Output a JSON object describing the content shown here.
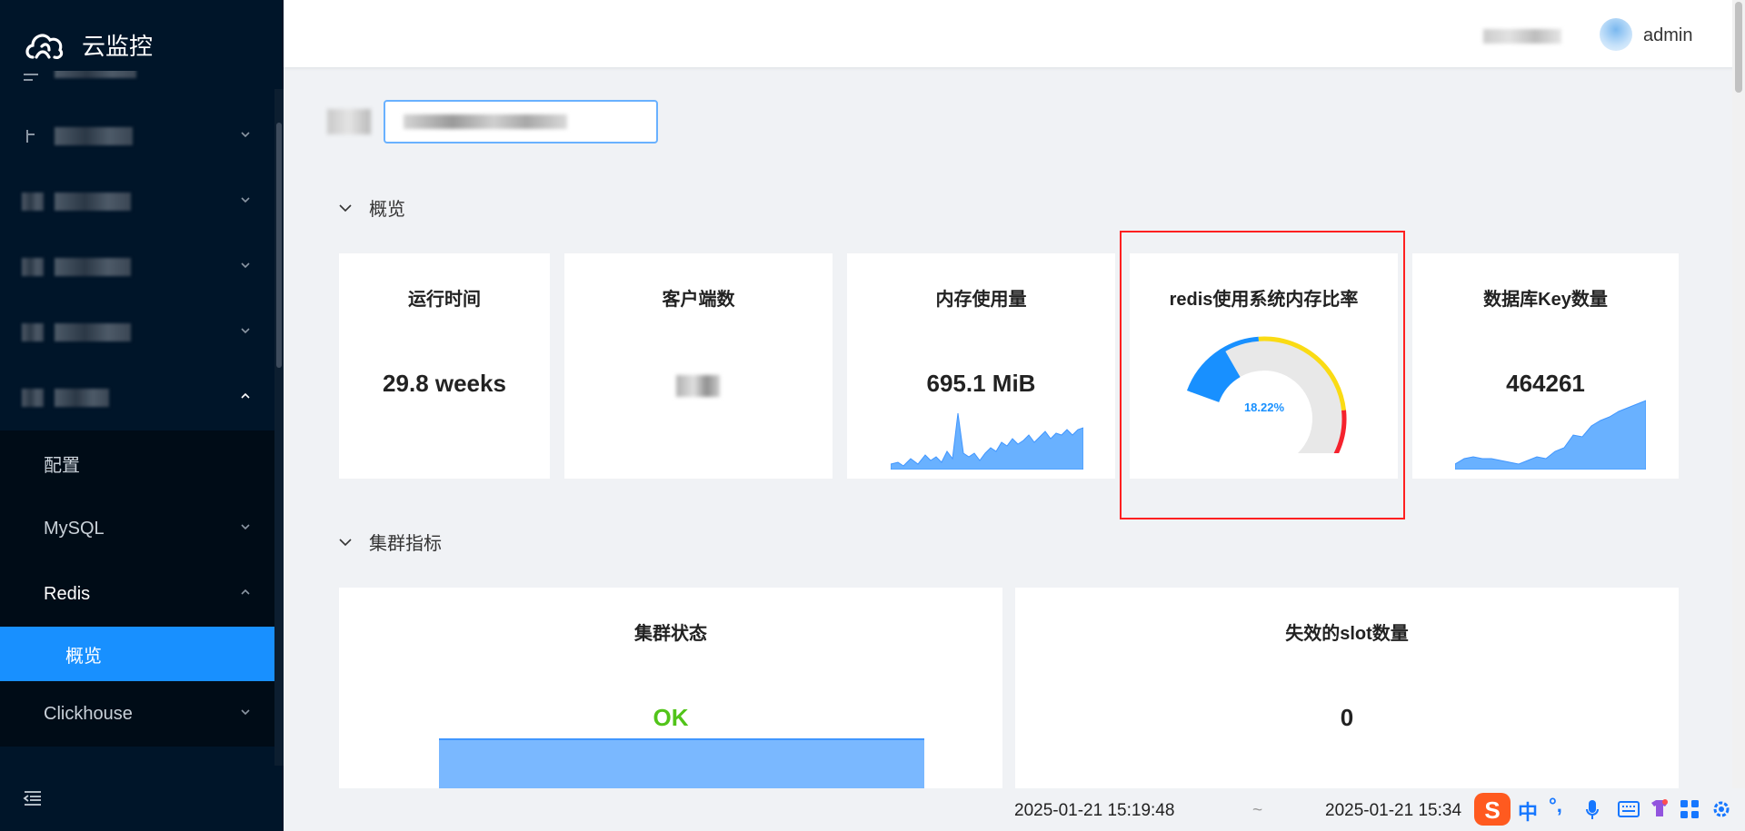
{
  "app": {
    "title": "云监控",
    "user": "admin"
  },
  "sidebar": {
    "submenu_items": [
      {
        "label": "配置"
      },
      {
        "label": "MySQL"
      },
      {
        "label": "Redis"
      },
      {
        "label": "概览"
      },
      {
        "label": "Clickhouse"
      }
    ]
  },
  "sections": {
    "overview": "概览",
    "cluster": "集群指标"
  },
  "overview_cards": {
    "uptime": {
      "title": "运行时间",
      "value": "29.8 weeks"
    },
    "clients": {
      "title": "客户端数"
    },
    "memory": {
      "title": "内存使用量",
      "value": "695.1 MiB"
    },
    "mem_ratio": {
      "title": "redis使用系统内存比率",
      "value": "18.22%",
      "fraction": 0.1822
    },
    "keys": {
      "title": "数据库Key数量",
      "value": "464261"
    }
  },
  "cluster_cards": {
    "state": {
      "title": "集群状态",
      "value": "OK"
    },
    "failed_slots": {
      "title": "失效的slot数量",
      "value": "0"
    }
  },
  "time_range": {
    "from": "2025-01-21 15:19:48",
    "separator": "~",
    "to": "2025-01-21 15:34"
  },
  "tray": {
    "ime": "中",
    "punct": "°,"
  },
  "colors": {
    "primary": "#1890ff",
    "sidebar": "#001529",
    "ok": "#52c41a",
    "gauge_blue": "#1890ff",
    "gauge_yellow": "#fadb14",
    "gauge_red": "#f5222d",
    "spark": "#69b1ff"
  }
}
